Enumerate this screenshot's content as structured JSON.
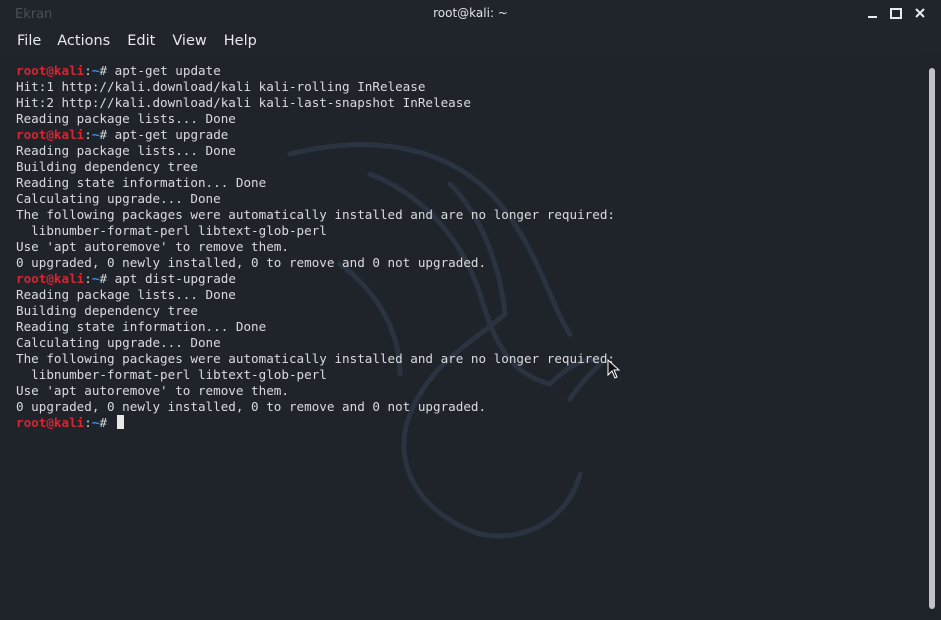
{
  "window": {
    "title": "root@kali: ~",
    "ghost_text": "Ekran",
    "controls": {
      "minimize": "minimize",
      "maximize": "maximize",
      "close": "close"
    }
  },
  "menu": [
    "File",
    "Actions",
    "Edit",
    "View",
    "Help"
  ],
  "prompt": {
    "user": "root@kali",
    "sep": ":",
    "path": "~",
    "symbol": "#"
  },
  "terminal": {
    "lines": [
      {
        "type": "prompt",
        "cmd": "apt-get update"
      },
      {
        "type": "out",
        "text": "Hit:1 http://kali.download/kali kali-rolling InRelease"
      },
      {
        "type": "out",
        "text": "Hit:2 http://kali.download/kali kali-last-snapshot InRelease"
      },
      {
        "type": "out",
        "text": "Reading package lists... Done"
      },
      {
        "type": "prompt",
        "cmd": "apt-get upgrade"
      },
      {
        "type": "out",
        "text": "Reading package lists... Done"
      },
      {
        "type": "out",
        "text": "Building dependency tree"
      },
      {
        "type": "out",
        "text": "Reading state information... Done"
      },
      {
        "type": "out",
        "text": "Calculating upgrade... Done"
      },
      {
        "type": "out",
        "text": "The following packages were automatically installed and are no longer required:"
      },
      {
        "type": "out",
        "text": "  libnumber-format-perl libtext-glob-perl"
      },
      {
        "type": "out",
        "text": "Use 'apt autoremove' to remove them."
      },
      {
        "type": "out",
        "text": "0 upgraded, 0 newly installed, 0 to remove and 0 not upgraded."
      },
      {
        "type": "prompt",
        "cmd": "apt dist-upgrade"
      },
      {
        "type": "out",
        "text": "Reading package lists... Done"
      },
      {
        "type": "out",
        "text": "Building dependency tree"
      },
      {
        "type": "out",
        "text": "Reading state information... Done"
      },
      {
        "type": "out",
        "text": "Calculating upgrade... Done"
      },
      {
        "type": "out",
        "text": "The following packages were automatically installed and are no longer required:"
      },
      {
        "type": "out",
        "text": "  libnumber-format-perl libtext-glob-perl"
      },
      {
        "type": "out",
        "text": "Use 'apt autoremove' to remove them."
      },
      {
        "type": "out",
        "text": "0 upgraded, 0 newly installed, 0 to remove and 0 not upgraded."
      },
      {
        "type": "prompt",
        "cmd": "",
        "cursor": true
      }
    ]
  },
  "colors": {
    "background": "#1f232a",
    "prompt_user": "#d6262f",
    "prompt_path": "#3b8fe0",
    "text": "#d9dcdf"
  },
  "icons": {
    "cursor": "text-cursor-block",
    "mouse": "mouse-pointer-icon",
    "watermark": "kali-dragon-logo"
  }
}
